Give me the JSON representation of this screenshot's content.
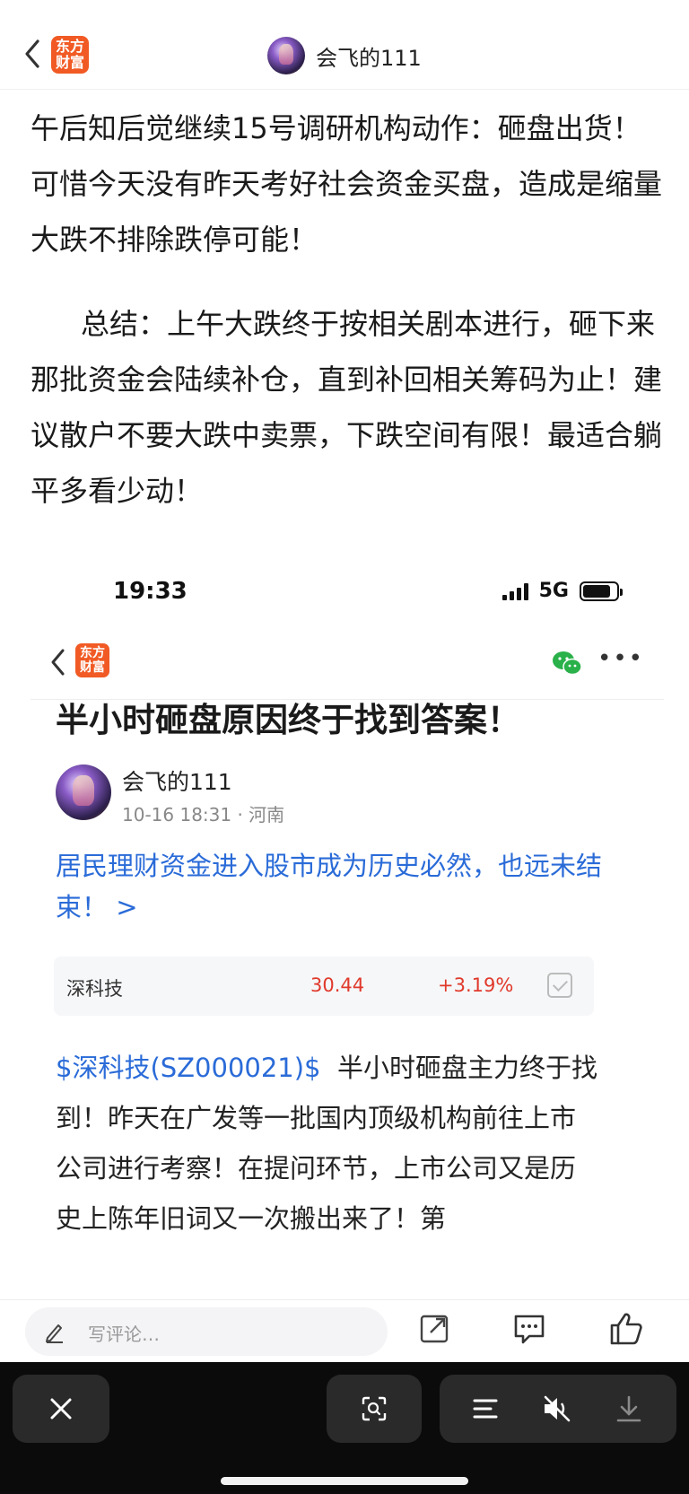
{
  "top_nav": {
    "logo_text": "东方财富",
    "username": "会飞的111"
  },
  "article": {
    "paragraph1": "午后知后觉继续15号调研机构动作：砸盘出货！可惜今天没有昨天考好社会资金买盘，造成是缩量大跌不排除跌停可能！",
    "paragraph2": "总结：上午大跌终于按相关剧本进行，砸下来那批资金会陆续补仓，直到补回相关筹码为止！建议散户不要大跌中卖票，下跌空间有限！最适合躺平多看少动！"
  },
  "embedded_screenshot": {
    "status_time": "19:33",
    "network": "5G",
    "logo_text": "东方财富",
    "post_title": "半小时砸盘原因终于找到答案！",
    "author_name": "会飞的111",
    "author_meta": "10-16 18:31 · 河南",
    "blue_link": "居民理财资金进入股市成为历史必然，也远未结束！ >",
    "stock": {
      "name": "深科技",
      "price": "30.44",
      "change": "+3.19%"
    },
    "stock_tag": "$深科技(SZ000021)$",
    "body_text": "半小时砸盘主力终于找到！昨天在广发等一批国内顶级机构前往上市公司进行考察！在提问环节，上市公司又是历史上陈年旧词又一次搬出来了！第"
  },
  "comment_bar": {
    "placeholder": "写评论…"
  },
  "icons": {
    "back": "chevron-left-icon",
    "wechat": "wechat-icon",
    "more": "more-dots-icon",
    "pen": "pen-icon",
    "share": "share-icon",
    "comment": "comment-icon",
    "like": "thumbs-up-icon",
    "close": "close-icon",
    "scan": "scan-icon",
    "list": "list-icon",
    "mute": "mute-icon",
    "download": "download-icon"
  },
  "colors": {
    "brand_orange": "#f15a24",
    "link_blue": "#2a6bd8",
    "stock_red": "#e0392b",
    "controls_bg": "#0b0b0b"
  }
}
